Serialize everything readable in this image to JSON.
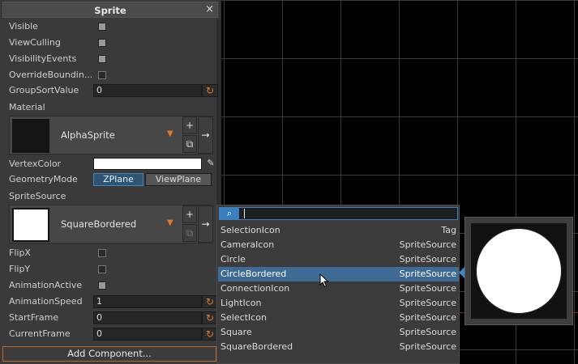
{
  "panel": {
    "title": "Sprite",
    "close_icon": "×",
    "add_component": "Add Component..."
  },
  "properties": {
    "visible": {
      "label": "Visible",
      "checked": true
    },
    "view_culling": {
      "label": "ViewCulling",
      "checked": true
    },
    "visibility_events": {
      "label": "VisibilityEvents",
      "checked": true
    },
    "override_bounding": {
      "label": "OverrideBoundin...",
      "checked": false
    },
    "group_sort_value": {
      "label": "GroupSortValue",
      "value": "0"
    },
    "material": {
      "label": "Material",
      "asset": "AlphaSprite"
    },
    "vertex_color": {
      "label": "VertexColor",
      "color": "#ffffff"
    },
    "geometry_mode": {
      "label": "GeometryMode",
      "option_a": "ZPlane",
      "option_b": "ViewPlane",
      "selected": "ZPlane"
    },
    "sprite_source": {
      "label": "SpriteSource",
      "asset": "SquareBordered"
    },
    "flip_x": {
      "label": "FlipX",
      "checked": false
    },
    "flip_y": {
      "label": "FlipY",
      "checked": false
    },
    "animation_active": {
      "label": "AnimationActive",
      "checked": true
    },
    "animation_speed": {
      "label": "AnimationSpeed",
      "value": "1"
    },
    "start_frame": {
      "label": "StartFrame",
      "value": "0"
    },
    "current_frame": {
      "label": "CurrentFrame",
      "value": "0"
    }
  },
  "icons": {
    "reset": "↻",
    "dropdown_caret": "▼",
    "add": "+",
    "copy": "⧉",
    "goto_arrow": "→",
    "eyedropper": "✎",
    "search": "⌕"
  },
  "dropdown": {
    "search_value": "",
    "items": [
      {
        "name": "SelectionIcon",
        "type": "Tag"
      },
      {
        "name": "CameraIcon",
        "type": "SpriteSource"
      },
      {
        "name": "Circle",
        "type": "SpriteSource"
      },
      {
        "name": "CircleBordered",
        "type": "SpriteSource"
      },
      {
        "name": "ConnectionIcon",
        "type": "SpriteSource"
      },
      {
        "name": "LightIcon",
        "type": "SpriteSource"
      },
      {
        "name": "SelectIcon",
        "type": "SpriteSource"
      },
      {
        "name": "Square",
        "type": "SpriteSource"
      },
      {
        "name": "SquareBordered",
        "type": "SpriteSource"
      }
    ],
    "highlighted": "CircleBordered"
  },
  "colors": {
    "accent": "#e07a2a",
    "selection": "#3f6a93",
    "focus": "#3a7fc0"
  }
}
